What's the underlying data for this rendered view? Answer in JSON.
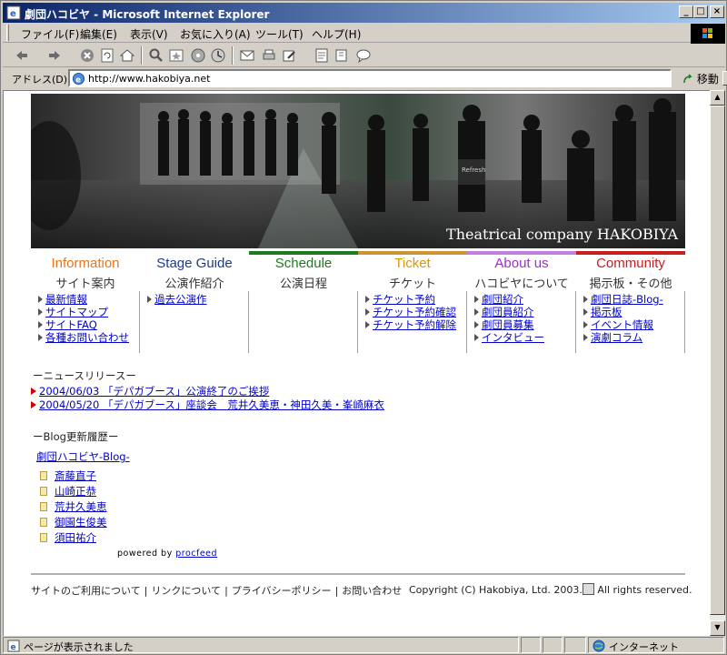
{
  "window": {
    "title": "劇団ハコビヤ - Microsoft Internet Explorer",
    "min": "_",
    "max": "□",
    "close": "×"
  },
  "menu": [
    "ファイル(F)",
    "編集(E)",
    "表示(V)",
    "お気に入り(A)",
    "ツール(T)",
    "ヘルプ(H)"
  ],
  "address": {
    "label": "アドレス(D)",
    "url": "http://www.hakobiya.net",
    "go_label": "移動"
  },
  "status": {
    "text": "ページが表示されました",
    "zone": "インターネット"
  },
  "page": {
    "banner_caption": "Theatrical company HAKOBIYA",
    "nav": [
      {
        "en": "Information",
        "jp": "サイト案内",
        "color": "#e8751a",
        "bar": "",
        "links": [
          "最新情報",
          "サイトマップ",
          "サイトFAQ",
          "各種お問い合わせ"
        ]
      },
      {
        "en": "Stage Guide",
        "jp": "公演作紹介",
        "color": "#1a3c8c",
        "bar": "",
        "links": [
          "過去公演作"
        ]
      },
      {
        "en": "Schedule",
        "jp": "公演日程",
        "color": "#1f7a1f",
        "bar": "#1f7a1f",
        "links": []
      },
      {
        "en": "Ticket",
        "jp": "チケット",
        "color": "#d99a00",
        "bar": "#c89632",
        "links": [
          "チケット予約",
          "チケット予約確認",
          "チケット予約解除"
        ]
      },
      {
        "en": "About us",
        "jp": "ハコビヤについて",
        "color": "#9b30c8",
        "bar": "#c080e0",
        "links": [
          "劇団紹介",
          "劇団員紹介",
          "劇団員募集",
          "インタビュー"
        ]
      },
      {
        "en": "Community",
        "jp": "掲示板・その他",
        "color": "#c81e1e",
        "bar": "#c81e1e",
        "links": [
          "劇団日誌-Blog-",
          "掲示板",
          "イベント情報",
          "演劇コラム"
        ]
      }
    ],
    "news_heading": "ーニュースリリースー",
    "news": [
      "2004/06/03 「デパガブース」公演終了のご挨拶",
      "2004/05/20 「デパガブース」座談会　荒井久美恵・神田久美・峯崎麻衣"
    ],
    "blog_heading": "ーBlog更新履歴ー",
    "blog_title": "劇団ハコビヤ-Blog-",
    "blog_entries": [
      "斎藤直子",
      "山崎正恭",
      "荒井久美恵",
      "御園生俊美",
      "須田祐介"
    ],
    "powered_prefix": "powered by",
    "powered_link": "procfeed",
    "footer_links": [
      "サイトのご利用について",
      "リンクについて",
      "プライバシーポリシー",
      "お問い合わせ"
    ],
    "copyright": "Copyright (C) Hakobiya, Ltd. 2003.",
    "copyright_suffix": "All rights reserved."
  }
}
